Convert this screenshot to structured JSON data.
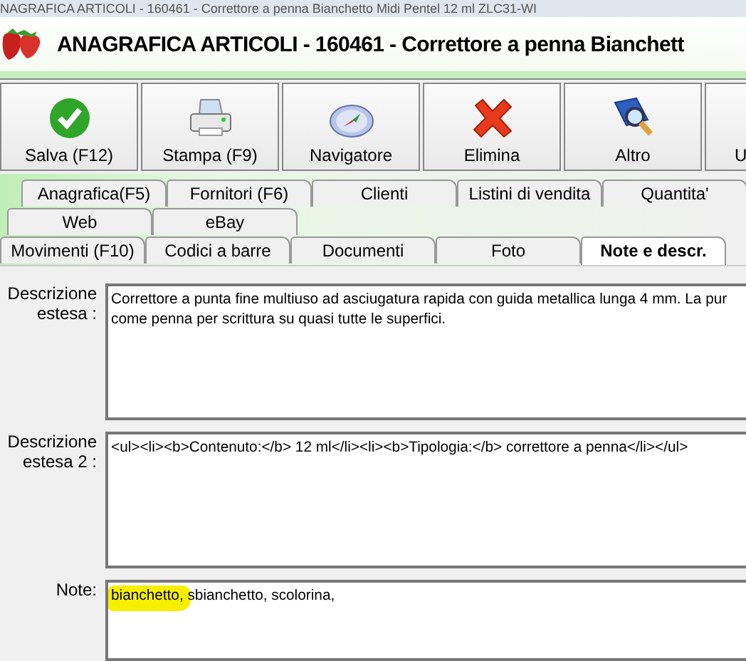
{
  "window": {
    "title": "NAGRAFICA ARTICOLI - 160461 - Correttore a penna Bianchetto Midi Pentel 12 ml ZLC31-WI"
  },
  "header": {
    "title": "ANAGRAFICA ARTICOLI - 160461 - Correttore a penna Bianchett"
  },
  "toolbar": [
    {
      "label": "Salva (F12)",
      "kind": "save"
    },
    {
      "label": "Stampa (F9)",
      "kind": "print"
    },
    {
      "label": "Navigatore",
      "kind": "navigator"
    },
    {
      "label": "Elimina",
      "kind": "delete"
    },
    {
      "label": "Altro",
      "kind": "other"
    },
    {
      "label": "U",
      "kind": "more"
    }
  ],
  "tab_rows": [
    [
      {
        "label": "Anagrafica(F5)",
        "selected": false
      },
      {
        "label": "Fornitori (F6)",
        "selected": false
      },
      {
        "label": "Clienti",
        "selected": false
      },
      {
        "label": "Listini di vendita",
        "selected": false
      },
      {
        "label": "Quantita'",
        "selected": false
      }
    ],
    [
      {
        "label": "Web",
        "selected": false
      },
      {
        "label": "eBay",
        "selected": false
      }
    ],
    [
      {
        "label": "Movimenti (F10)",
        "selected": false
      },
      {
        "label": "Codici a barre",
        "selected": false
      },
      {
        "label": "Documenti",
        "selected": false
      },
      {
        "label": "Foto",
        "selected": false
      },
      {
        "label": "Note e descr.",
        "selected": true
      }
    ]
  ],
  "fields": [
    {
      "label": "Descrizione estesa :",
      "lines": [
        "Correttore a punta fine multiuso ad asciugatura rapida con guida metallica lunga 4 mm. La pur",
        "come penna per scrittura su quasi tutte le superfici."
      ]
    },
    {
      "label": "Descrizione estesa 2 :",
      "lines": [
        "<ul><li><b>Contenuto:</b> 12 ml</li><li><b>Tipologia:</b> correttore a penna</li></ul>"
      ]
    },
    {
      "label": "Note:",
      "lines": [
        "bianchetto, sbianchetto, scolorina,"
      ],
      "highlighted": true
    }
  ]
}
